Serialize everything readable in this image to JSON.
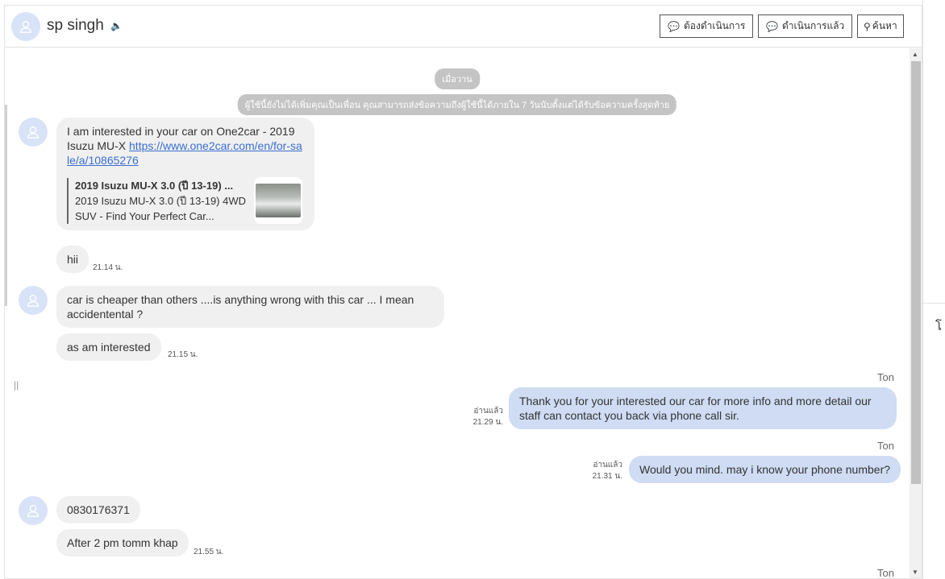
{
  "header": {
    "contact_name": "sp singh",
    "buttons": {
      "todo": "ต้องดำเนินการ",
      "done": "ดำเนินการแล้ว",
      "search": "ค้นหา"
    }
  },
  "chat": {
    "date_label": "เมื่อวาน",
    "notice": "ผู้ใช้นี้ยังไม่ได้เพิ่มคุณเป็นเพื่อน คุณสามารถส่งข้อความถึงผู้ใช้นี้ได้ภายใน 7 วันนับตั้งแต่ได้รับข้อความครั้งสุดท้าย",
    "messages": [
      {
        "text": "I am interested in your car on One2car - 2019 Isuzu MU-X ",
        "link": "https://www.one2car.com/en/for-sale/a/10865276",
        "preview_title": "2019 Isuzu MU-X 3.0 (ปี 13-19) ...",
        "preview_desc": "2019 Isuzu MU-X 3.0 (ปี 13-19) 4WD SUV - Find Your Perfect Car..."
      },
      {
        "text": "hii",
        "time": "21.14 น."
      },
      {
        "text": "car is cheaper than others ....is anything wrong with this car ... I mean accidentental ?"
      },
      {
        "text": "as am interested",
        "time": "21.15 น."
      },
      {
        "sender": "Ton",
        "text": "Thank you for your interested our car for more info and more detail our staff can contact you back via phone call sir.",
        "status": "อ่านแล้ว",
        "time": "21.29 น."
      },
      {
        "sender": "Ton",
        "text": "Would you mind. may i know your phone number?",
        "status": "อ่านแล้ว",
        "time": "21.31 น."
      },
      {
        "text": "0830176371"
      },
      {
        "text": "After 2 pm tomm khap",
        "time": "21.55 น."
      },
      {
        "sender": "Ton"
      }
    ]
  },
  "right_panel": {
    "partial_text": "โ"
  }
}
